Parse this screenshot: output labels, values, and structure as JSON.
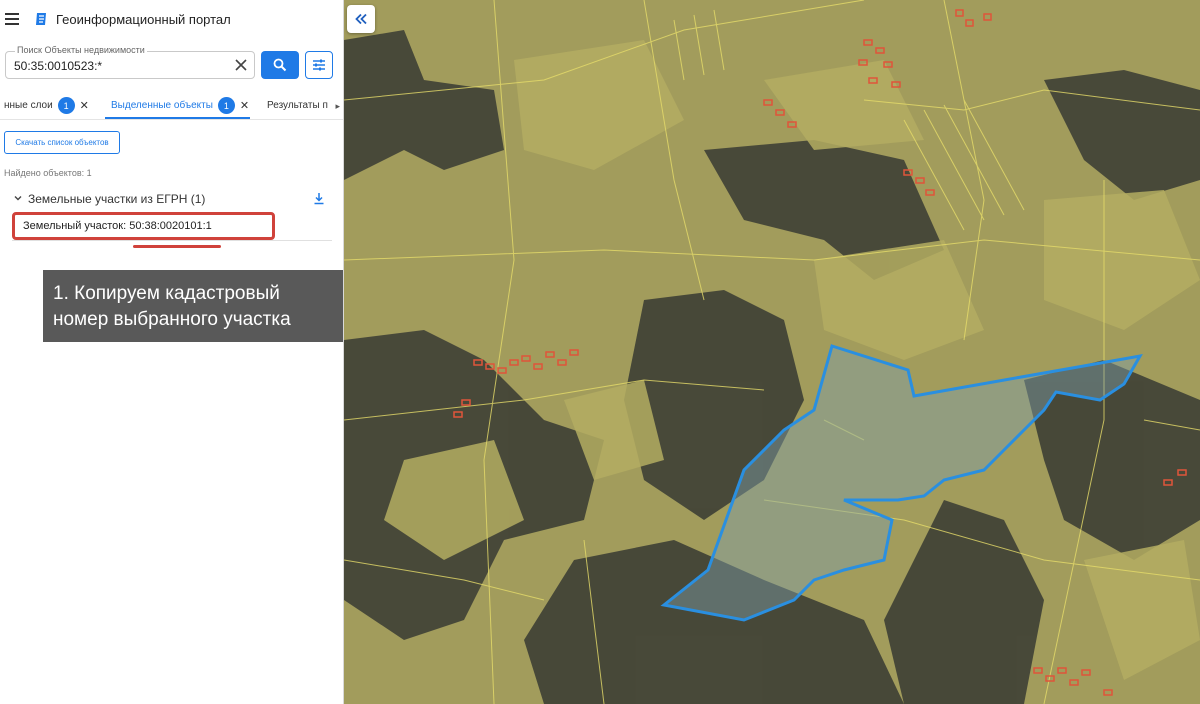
{
  "app": {
    "title": "Геоинформационный портал"
  },
  "search": {
    "label": "Поиск Объекты недвижимости",
    "value": "50:35:0010523:*"
  },
  "tabs": [
    {
      "label": "нные слои",
      "badge": "1"
    },
    {
      "label": "Выделенные объекты",
      "badge": "1"
    },
    {
      "label": "Результаты п"
    }
  ],
  "toolbar": {
    "download_list_label": "Скачать список объектов"
  },
  "results": {
    "found_text": "Найдено объектов: 1",
    "group_title": "Земельные участки из ЕГРН (1)",
    "items": [
      {
        "label": "Земельный участок: 50:38:0020101:1"
      }
    ]
  },
  "callout": {
    "line1": "1. Копируем кадастровый",
    "line2": "номер выбранного участка"
  },
  "colors": {
    "accent": "#1f7ae6",
    "highlight": "#d0423b",
    "parcel_outline": "#2a8fe0",
    "callout_bg": "#595959"
  },
  "icons": {
    "menu": "hamburger-icon",
    "logo": "portal-logo-icon",
    "clear": "close-icon",
    "search": "search-icon",
    "filter": "filter-settings-icon",
    "download": "download-icon",
    "collapse": "double-chevron-left-icon",
    "group": "chevron-down-icon"
  }
}
